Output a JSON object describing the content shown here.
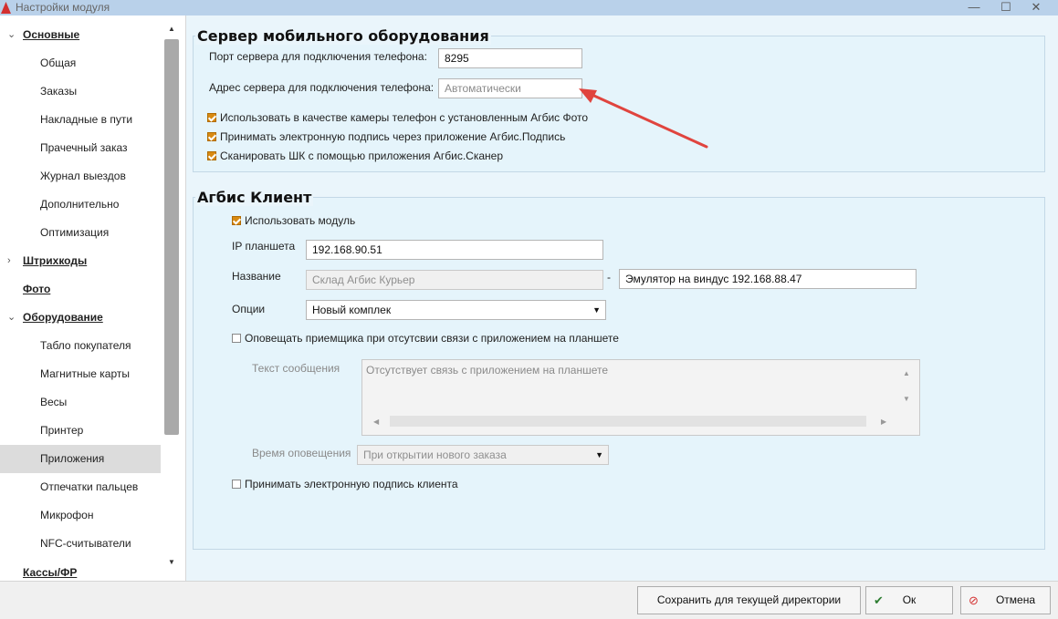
{
  "window": {
    "title": "Настройки модуля",
    "controls": {
      "minimize": "—",
      "maximize": "☐",
      "close": "✕"
    }
  },
  "sidebar": {
    "items": [
      {
        "label": "Основные",
        "type": "group",
        "expanded": true
      },
      {
        "label": "Общая",
        "type": "item"
      },
      {
        "label": "Заказы",
        "type": "item"
      },
      {
        "label": "Накладные в пути",
        "type": "item"
      },
      {
        "label": "Прачечный заказ",
        "type": "item"
      },
      {
        "label": "Журнал выездов",
        "type": "item"
      },
      {
        "label": "Дополнительно",
        "type": "item"
      },
      {
        "label": "Оптимизация",
        "type": "item"
      },
      {
        "label": "Штрихкоды",
        "type": "group",
        "expanded": false
      },
      {
        "label": "Фото",
        "type": "group"
      },
      {
        "label": "Оборудование",
        "type": "group",
        "expanded": true
      },
      {
        "label": "Табло покупателя",
        "type": "item"
      },
      {
        "label": "Магнитные карты",
        "type": "item"
      },
      {
        "label": "Весы",
        "type": "item"
      },
      {
        "label": "Принтер",
        "type": "item"
      },
      {
        "label": "Приложения",
        "type": "item",
        "selected": true
      },
      {
        "label": "Отпечатки пальцев",
        "type": "item"
      },
      {
        "label": "Микрофон",
        "type": "item"
      },
      {
        "label": "NFC-считыватели",
        "type": "item"
      },
      {
        "label": "Кассы/ФР",
        "type": "group"
      }
    ]
  },
  "mobile_server": {
    "title": "Сервер мобильного оборудования",
    "port_label": "Порт сервера для подключения телефона:",
    "port_value": "8295",
    "address_label": "Адрес сервера для подключения телефона:",
    "address_placeholder": "Автоматически",
    "checks": [
      {
        "label": "Использовать в качестве камеры телефон с установленным Агбис Фото",
        "checked": true
      },
      {
        "label": "Принимать электронную подпись через приложение Агбис.Подпись",
        "checked": true
      },
      {
        "label": "Сканировать ШК с помощью приложения Агбис.Сканер",
        "checked": true
      }
    ]
  },
  "agbis_client": {
    "title": "Агбис Клиент",
    "use_module_label": "Использовать модуль",
    "use_module_checked": true,
    "ip_label": "IP планшета",
    "ip_value": "192.168.90.51",
    "name_label": "Название",
    "name_value": "Склад Агбис Курьер",
    "name_separator": "-",
    "name_value2": "Эмулятор на виндус 192.168.88.47",
    "options_label": "Опции",
    "options_value": "Новый комплек",
    "notify_label": "Оповещать приемщика при отсутсвии связи с приложением на планшете",
    "notify_checked": false,
    "message_label": "Текст сообщения",
    "message_value": "Отсутствует связь с приложением на планшете",
    "time_label": "Время оповещения",
    "time_value": "При открытии нового заказа",
    "signature_label": "Принимать электронную подпись клиента",
    "signature_checked": false
  },
  "footer": {
    "save_dir_label": "Сохранить для текущей директории",
    "ok_label": "Ок",
    "cancel_label": "Отмена"
  },
  "colors": {
    "accent_check": "#d88a12",
    "panel_bg": "#eaf5fb",
    "annotation_arrow": "#e0443e"
  }
}
